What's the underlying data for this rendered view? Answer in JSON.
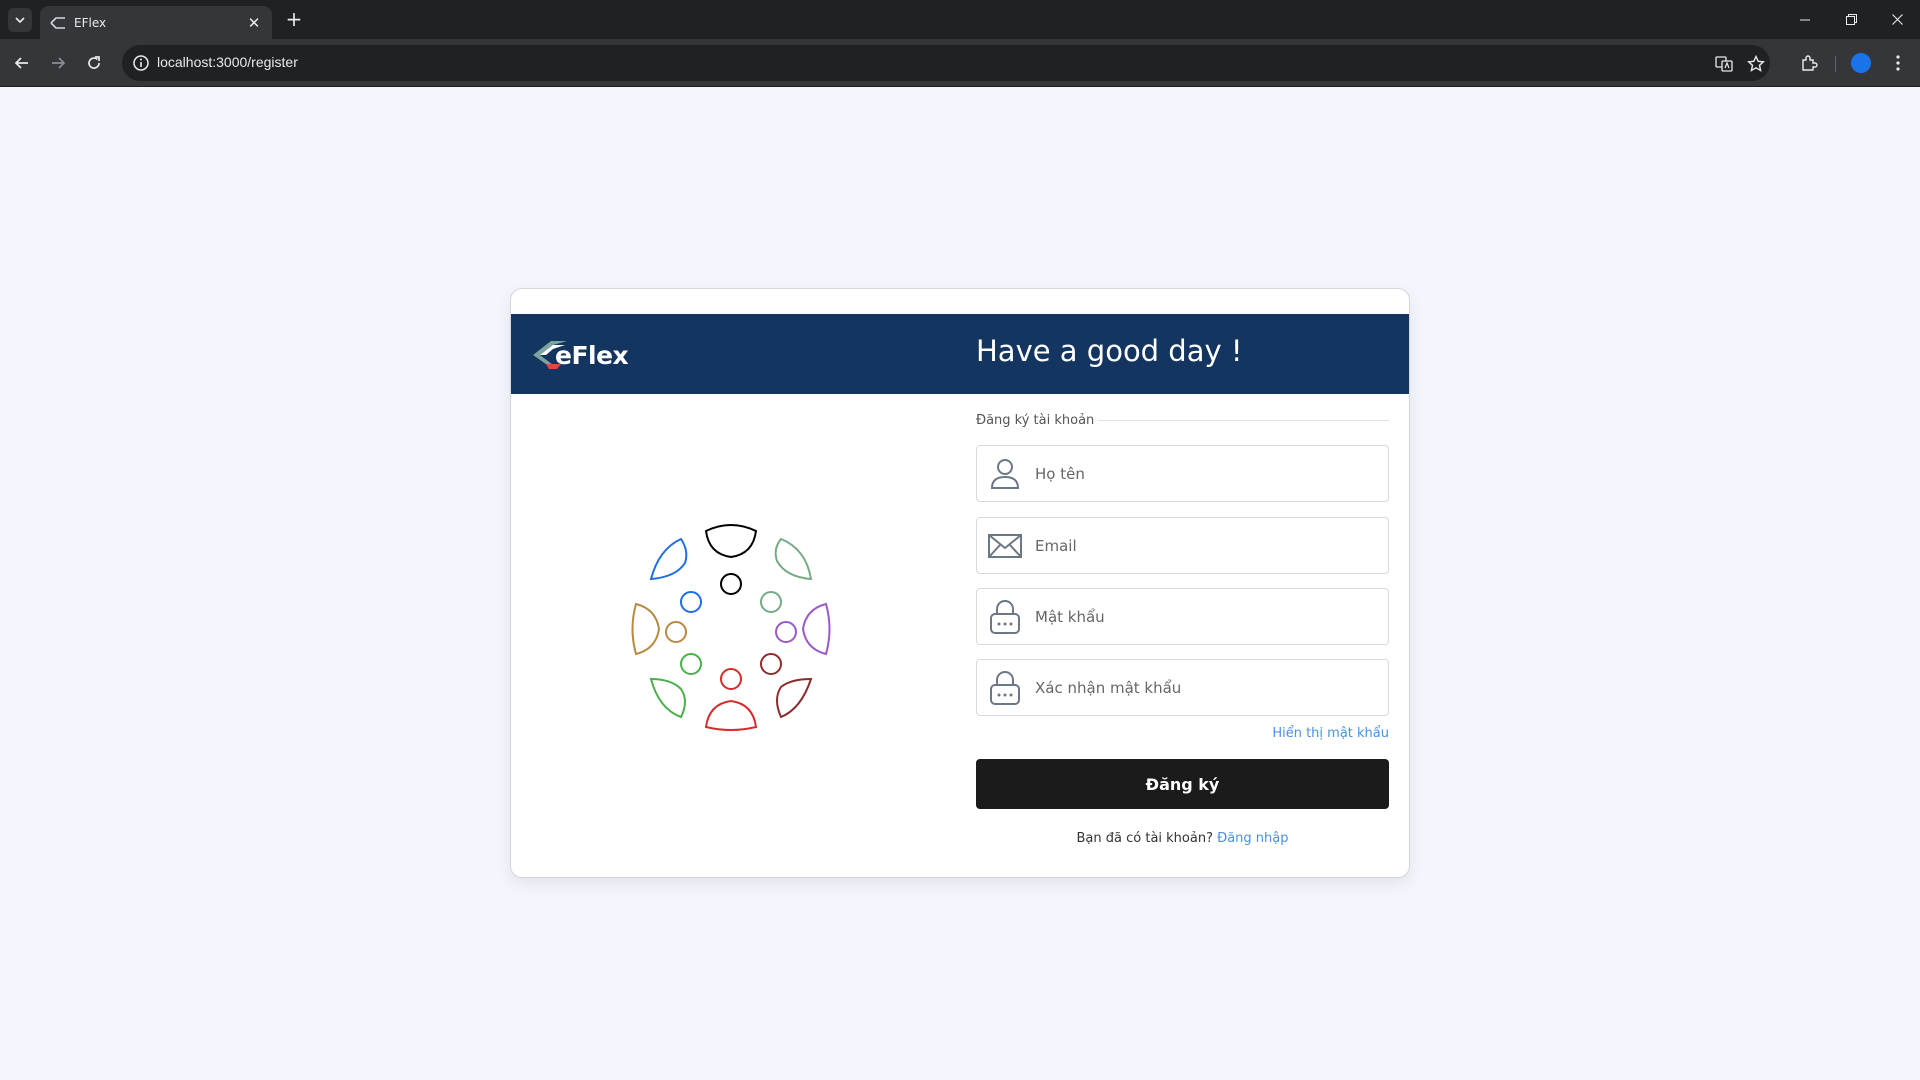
{
  "browser": {
    "tab_title": "EFlex",
    "tab_close": "✕",
    "new_tab": "+",
    "url": "localhost:3000/register",
    "icons": [
      "tab-search-icon",
      "back-icon",
      "forward-icon",
      "reload-icon",
      "site-info-icon",
      "translate-icon",
      "bookmark-star-icon",
      "extensions-icon",
      "profile-icon",
      "menu-icon",
      "minimize-icon",
      "restore-icon",
      "close-icon"
    ]
  },
  "header": {
    "brand": "eFlex",
    "greeting": "Have a good day !"
  },
  "form": {
    "section_title": "Đăng ký tài khoản",
    "fullname_placeholder": "Họ tên",
    "email_placeholder": "Email",
    "password_placeholder": "Mật khẩu",
    "confirm_placeholder": "Xác nhận mật khẩu",
    "show_password": "Hiển thị mật khẩu",
    "submit_label": "Đăng ký",
    "have_account": "Bạn đã có tài khoản?",
    "login_link": "Đăng nhập"
  },
  "colors": {
    "header_bg": "#14355f",
    "page_bg": "#f3f7fd",
    "button_bg": "#1b1b1b",
    "link": "#4a90e2"
  }
}
